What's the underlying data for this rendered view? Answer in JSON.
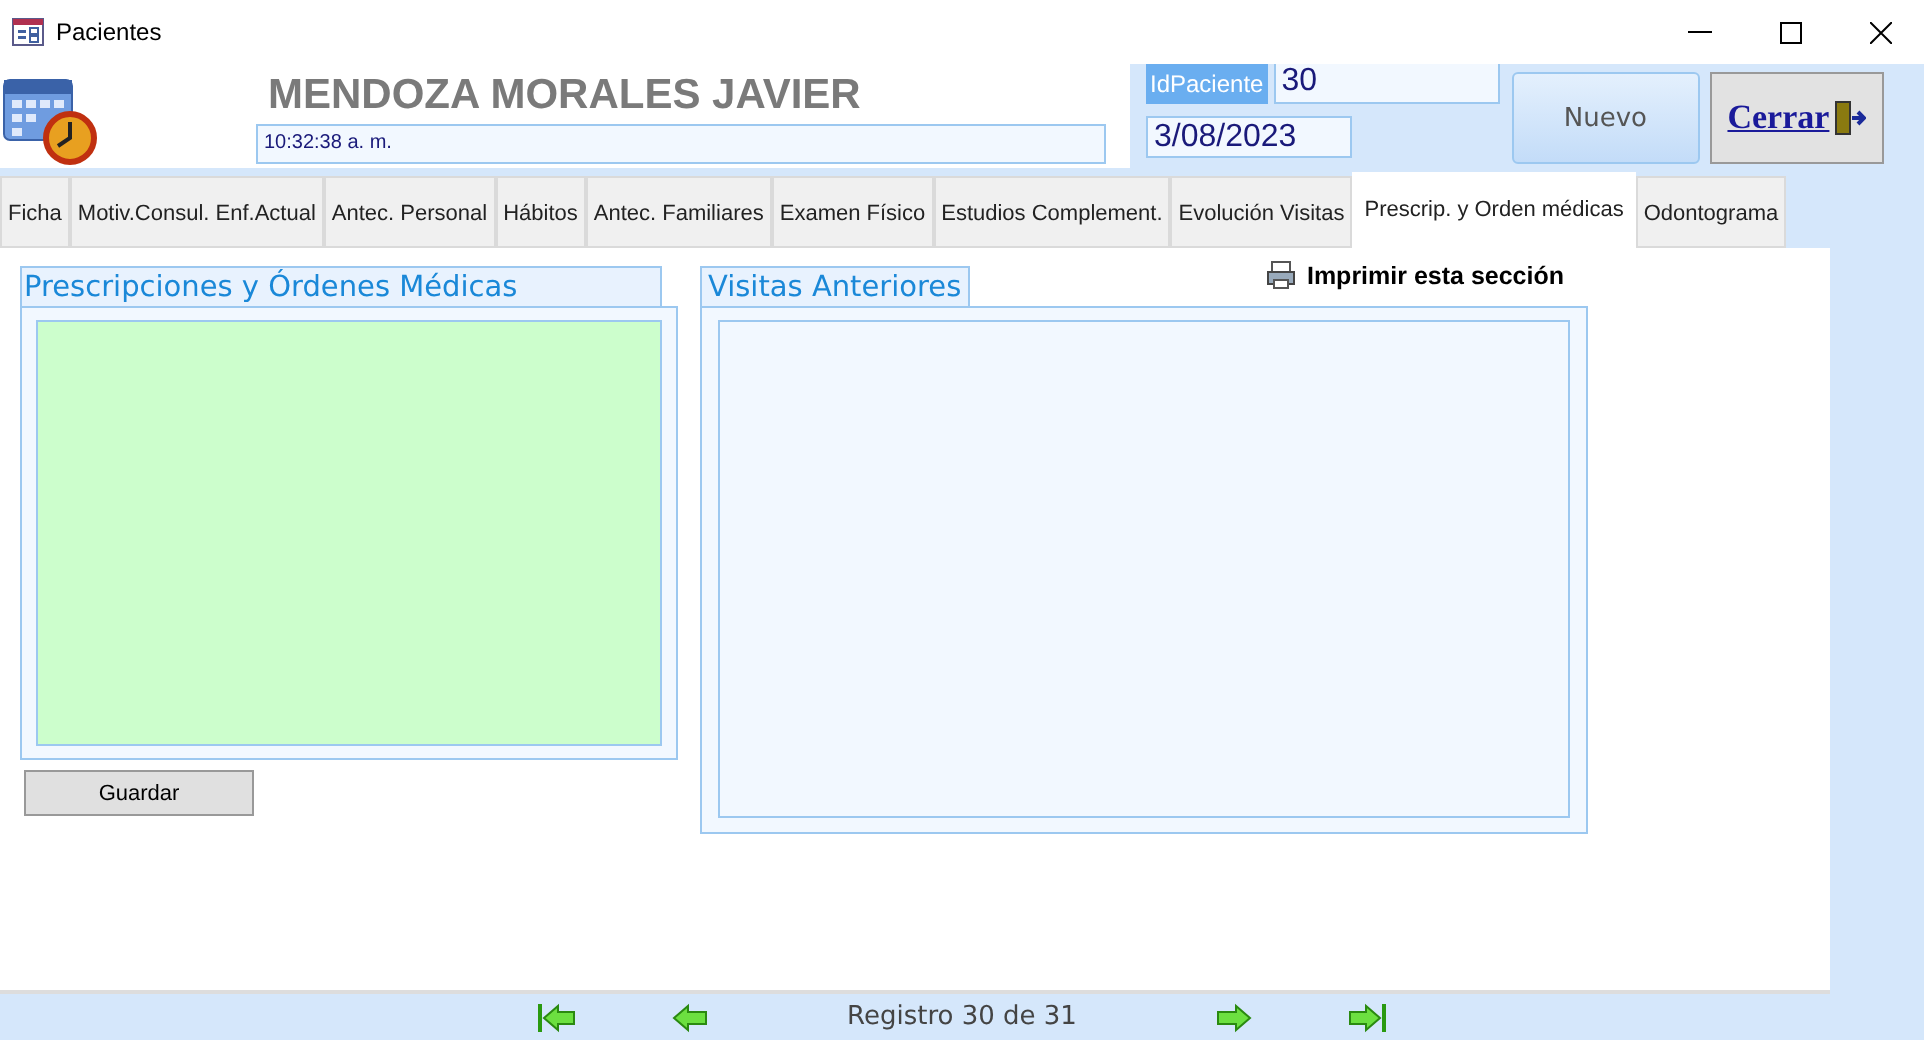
{
  "window": {
    "title": "Pacientes"
  },
  "header": {
    "patient_name": "MENDOZA MORALES JAVIER",
    "time": "10:32:38 a. m.",
    "id_label": "IdPaciente",
    "id_value": "30",
    "date": "3/08/2023",
    "new_button": "Nuevo",
    "close_button": "Cerrar"
  },
  "tabs": [
    {
      "label": "Ficha",
      "selected": false
    },
    {
      "label": "Motiv.Consul. Enf.Actual",
      "selected": false
    },
    {
      "label": "Antec. Personal",
      "selected": false
    },
    {
      "label": "Hábitos",
      "selected": false
    },
    {
      "label": "Antec. Familiares",
      "selected": false
    },
    {
      "label": "Examen Físico",
      "selected": false
    },
    {
      "label": "Estudios Complement.",
      "selected": false
    },
    {
      "label": "Evolución Visitas",
      "selected": false
    },
    {
      "label": "Prescrip. y Orden médicas",
      "selected": true
    },
    {
      "label": "Odontograma",
      "selected": false
    }
  ],
  "prescriptions": {
    "title": "Prescripciones y Órdenes Médicas",
    "save_button": "Guardar"
  },
  "visits": {
    "title": "Visitas Anteriores",
    "print_link": "Imprimir esta sección"
  },
  "navigation": {
    "record": "Registro 30 de 31"
  }
}
